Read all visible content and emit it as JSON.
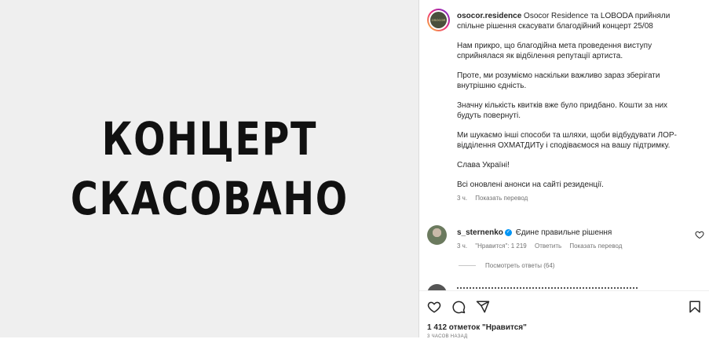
{
  "post_image": {
    "line1": "КОНЦЕРТ",
    "line2": "СКАСОВАНО"
  },
  "author": {
    "username": "osocor.residence",
    "avatar_text": "OSOCOR"
  },
  "caption": {
    "paragraphs": [
      "Osocor Residence та LOBODA прийняли спільне рішення скасувати благодійний концерт 25/08",
      "Нам прикро, що благодійна мета проведення виступу сприйнялася як відбілення репутації артиста.",
      "Проте, ми розуміємо наскільки важливо зараз зберігати внутрішню єдність.",
      "Значну кількість квитків вже було придбано. Кошти за них будуть повернуті.",
      "Ми шукаємо інші способи та шляхи, щоби відбудувати ЛОР-відділення ОХМАТДИТу і сподіваємося на вашу підтримку.",
      "Слава Україні!",
      "Всі оновлені анонси на сайті резиденції."
    ],
    "time": "3 ч.",
    "translate": "Показать перевод"
  },
  "comment": {
    "username": "s_sternenko",
    "text": "Єдине правильне рішення",
    "time": "3 ч.",
    "likes": "\"Нравится\": 1 219",
    "reply": "Ответить",
    "translate": "Показать перевод",
    "view_replies": "Посмотреть ответы (64)"
  },
  "footer": {
    "likes": "1 412 отметок \"Нравится\"",
    "time": "3 ЧАСОВ НАЗАД"
  },
  "icons": [
    "heart-icon",
    "comment-icon",
    "share-icon",
    "bookmark-icon",
    "verified-icon"
  ]
}
